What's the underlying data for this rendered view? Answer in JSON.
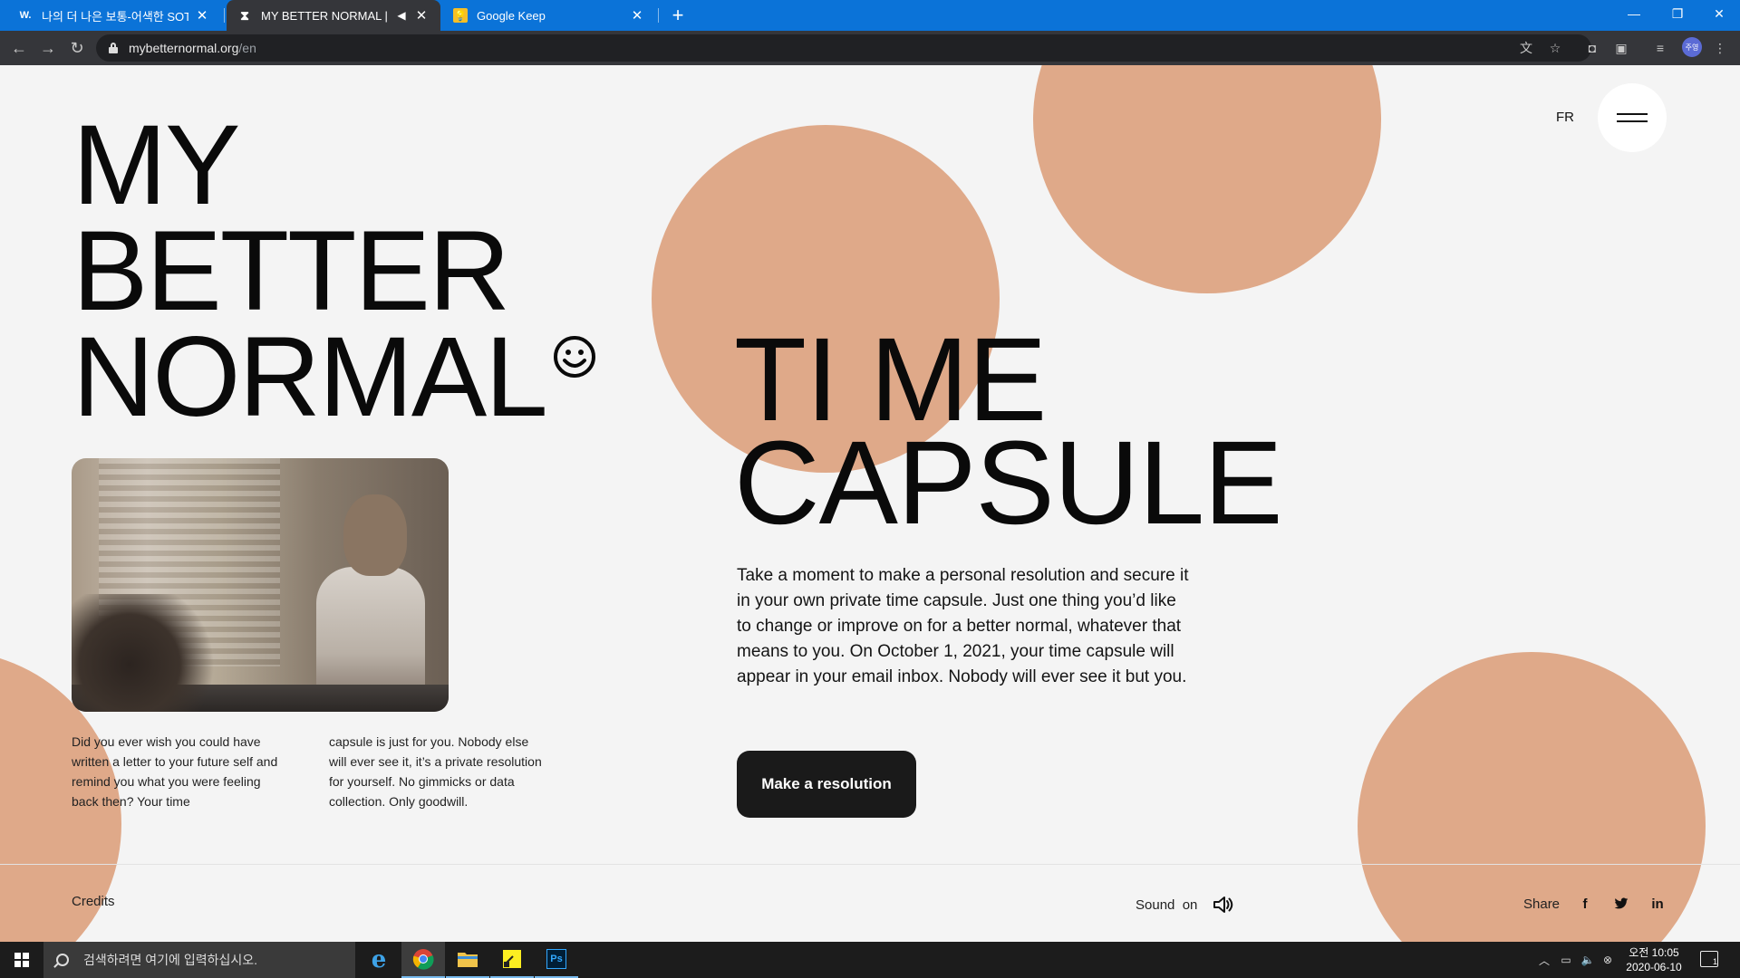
{
  "browser": {
    "tabs": [
      {
        "title": "나의 더 나은 보통-어색한 SOTD",
        "favicon": "W."
      },
      {
        "title": "MY BETTER NORMAL | TI:M",
        "favicon": "⧗"
      },
      {
        "title": "Google Keep",
        "favicon": ""
      }
    ],
    "url_host": "mybetternormal.org",
    "url_path": "/en",
    "profile_initials": "주영"
  },
  "site": {
    "title_lines": [
      "MY",
      "BETTER",
      "NORMAL"
    ],
    "lang_switch": "FR",
    "intro_col1": "Did you ever wish you could have written a letter to your future self and remind you what you were feeling back then? Your time",
    "intro_col2": "capsule is just for you. Nobody else will ever see it, it’s a private resolution for yourself. No gimmicks or data collection. Only goodwill.",
    "capsule_title_lines": [
      "TI ME",
      "CAPSULE"
    ],
    "capsule_text": "Take a moment to make a personal resolution and secure it in your own private time capsule. Just one thing you’d like to change or improve on for a better normal, whatever that means to you. On October 1, 2021, your time capsule will appear in your email inbox. Nobody will ever see it but you.",
    "cta_label": "Make a resolution",
    "footer": {
      "credits": "Credits",
      "sound": "Sound  on",
      "share": "Share"
    },
    "accent_color": "#dfa989"
  },
  "taskbar": {
    "search_placeholder": "검색하려면 여기에 입력하십시오.",
    "clock_time": "오전 10:05",
    "clock_date": "2020-06-10",
    "notifications": "1"
  }
}
